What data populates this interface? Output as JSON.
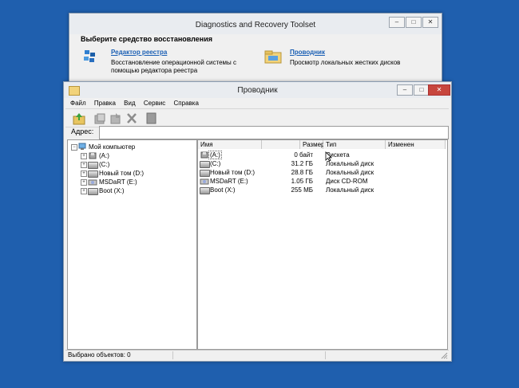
{
  "dart_window": {
    "title": "Diagnostics and Recovery Toolset",
    "heading": "Выберите средство восстановления",
    "tools": [
      {
        "name": "Редактор реестра",
        "desc_line1": "Восстановление операционной системы с",
        "desc_line2": "помощью редактора реестра",
        "icon": "registry-editor-icon"
      },
      {
        "name": "Проводник",
        "desc_line1": "Просмотр локальных жестких дисков",
        "icon": "explorer-icon"
      }
    ]
  },
  "explorer": {
    "title": "Проводник",
    "menu": [
      "Файл",
      "Правка",
      "Вид",
      "Сервис",
      "Справка"
    ],
    "address_label": "Адрес:",
    "address_value": "",
    "tree": {
      "root": "Мой компьютер",
      "children": [
        "(A:)",
        "(C:)",
        "Новый том (D:)",
        "MSDaRT (E:)",
        "Boot (X:)"
      ]
    },
    "columns": [
      "Имя",
      "Размер",
      "Тип",
      "Изменен"
    ],
    "rows": [
      {
        "name": "(A:)",
        "size": "0 байт",
        "type": "Дискета"
      },
      {
        "name": "(C:)",
        "size": "31.2 ГБ",
        "type": "Локальный диск"
      },
      {
        "name": "Новый том (D:)",
        "size": "28.8 ГБ",
        "type": "Локальный диск"
      },
      {
        "name": "MSDaRT (E:)",
        "size": "1.05 ГБ",
        "type": "Диск CD-ROM"
      },
      {
        "name": "Boot (X:)",
        "size": "255 МБ",
        "type": "Локальный диск"
      }
    ],
    "status": "Выбрано объектов: 0"
  },
  "colors": {
    "desktop": "#1f5fae",
    "link": "#1a5fb4",
    "close": "#c7463d"
  }
}
